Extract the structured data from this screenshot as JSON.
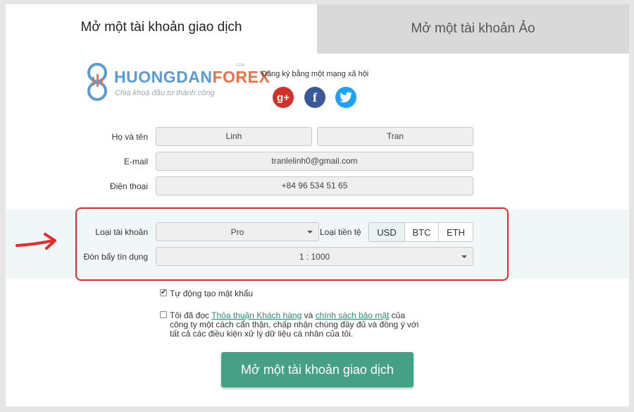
{
  "tabs": {
    "live": "Mở một tài khoản giao dịch",
    "demo": "Mở một tài khoản Ảo"
  },
  "logo": {
    "part1": "HUONGDAN",
    "part2": "FOREX",
    "com": ".COM",
    "slogan": "Chia khoá đầu tư thành công"
  },
  "social": {
    "title": "Đăng ký bằng một mạng xã hội",
    "google": "g+",
    "facebook": "f",
    "twitter_icon": "twitter-bird"
  },
  "form": {
    "name_label": "Họ và tên",
    "first_name": "Linh",
    "last_name": "Tran",
    "email_label": "E-mail",
    "email": "tranlelinh0@gmail.com",
    "phone_label": "Điện thoại",
    "phone": "+84 96 534 51 65",
    "account_type_label": "Loại tài khoản",
    "account_type": "Pro",
    "currency_label": "Loại tiền tệ",
    "currencies": [
      "USD",
      "BTC",
      "ETH"
    ],
    "leverage_label": "Đòn bẩy tín dụng",
    "leverage": "1 : 1000",
    "auto_password": "Tự động tạo mật khẩu",
    "terms": {
      "pre": "Tôi đã đọc ",
      "link1": "Thỏa thuận Khách hàng",
      "mid": " và ",
      "link2": "chính sách bảo mật",
      "post": " của",
      "line2": "công ty một cách cẩn thận, chấp nhận chúng đầy đủ và đồng ý với",
      "line3": "tất cả các điều kiện xử lý dữ liệu cá nhân của tôi."
    },
    "submit": "Mở một tài khoản giao dịch"
  },
  "colors": {
    "accent": "#46a184",
    "highlight": "#e52a2a"
  }
}
